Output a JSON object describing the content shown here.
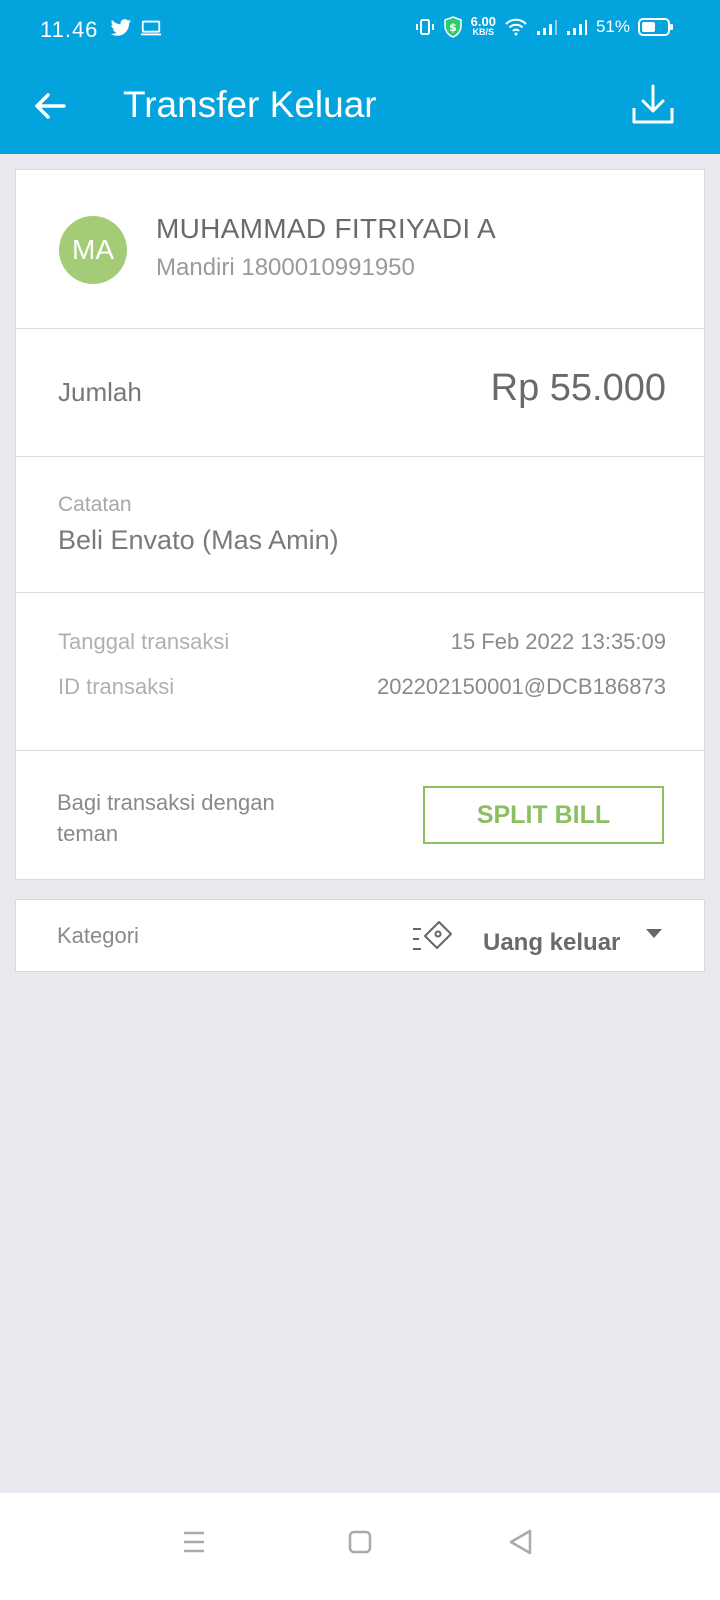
{
  "status_bar": {
    "time": "11.46",
    "net_speed_value": "6.00",
    "net_speed_unit": "KB/S",
    "battery": "51%"
  },
  "app_bar": {
    "title": "Transfer Keluar"
  },
  "recipient": {
    "initials": "MA",
    "name": "MUHAMMAD FITRIYADI A",
    "bank": "Mandiri 1800010991950",
    "avatar_color": "#a4cc76"
  },
  "amount": {
    "label": "Jumlah",
    "value": "Rp 55.000"
  },
  "note": {
    "label": "Catatan",
    "value": "Beli Envato (Mas Amin)"
  },
  "transaction": {
    "date_label": "Tanggal transaksi",
    "date_value": "15 Feb 2022 13:35:09",
    "id_label": "ID transaksi",
    "id_value": "202202150001@DCB186873"
  },
  "split": {
    "text": "Bagi transaksi dengan teman",
    "button": "SPLIT BILL",
    "accent": "#8bc060"
  },
  "category": {
    "label": "Kategori",
    "value": "Uang keluar",
    "icon": "tag-icon"
  },
  "theme": {
    "primary": "#03a3dd",
    "background": "#e8e8ee"
  }
}
